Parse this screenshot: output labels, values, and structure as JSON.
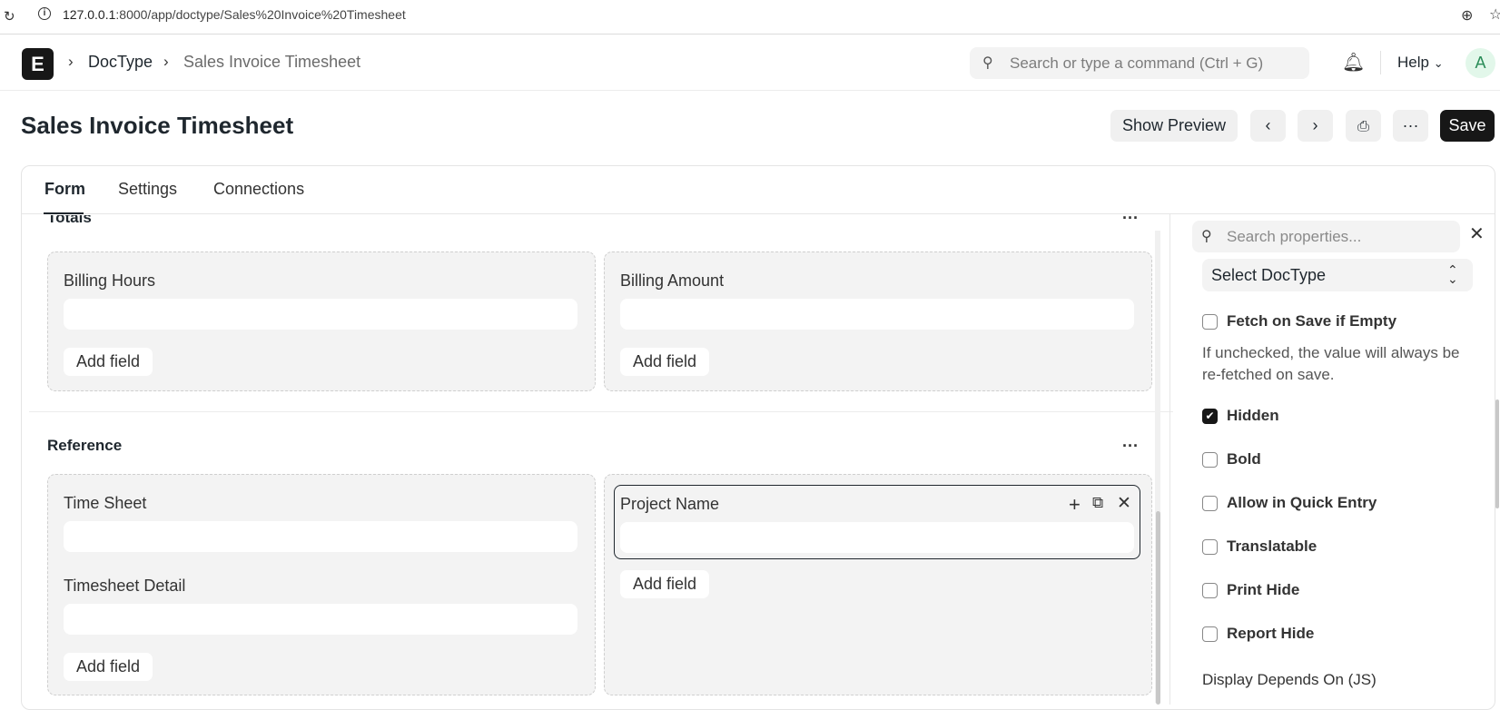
{
  "browser": {
    "url_host": "127.0.0.1",
    "url_rest": ":8000/app/doctype/Sales%20Invoice%20Timesheet"
  },
  "nav": {
    "logo": "E",
    "breadcrumbs": [
      "DocType",
      "Sales Invoice Timesheet"
    ],
    "search_placeholder": "Search or type a command (Ctrl + G)",
    "help_label": "Help",
    "avatar_initial": "A"
  },
  "page": {
    "title": "Sales Invoice Timesheet",
    "show_preview": "Show Preview",
    "save": "Save",
    "more": "···"
  },
  "tabs": [
    "Form",
    "Settings",
    "Connections"
  ],
  "form": {
    "section_totals": {
      "title": "Totals",
      "columns": [
        {
          "fields": [
            "Billing Hours"
          ],
          "add_field": "Add field"
        },
        {
          "fields": [
            "Billing Amount"
          ],
          "add_field": "Add field"
        }
      ]
    },
    "section_reference": {
      "title": "Reference",
      "columns": [
        {
          "fields": [
            "Time Sheet",
            "Timesheet Detail"
          ],
          "add_field": "Add field"
        },
        {
          "fields": [
            "Project Name"
          ],
          "add_field": "Add field"
        }
      ]
    }
  },
  "sidebar": {
    "search_placeholder": "Search properties...",
    "select_doctype": "Select DocType",
    "fetch_on_save": "Fetch on Save if Empty",
    "fetch_desc": "If unchecked, the value will always be re-fetched on save.",
    "checkboxes": [
      {
        "label": "Hidden",
        "checked": true
      },
      {
        "label": "Bold",
        "checked": false
      },
      {
        "label": "Allow in Quick Entry",
        "checked": false
      },
      {
        "label": "Translatable",
        "checked": false
      },
      {
        "label": "Print Hide",
        "checked": false
      },
      {
        "label": "Report Hide",
        "checked": false
      }
    ],
    "display_depends_on": "Display Depends On (JS)"
  },
  "colors": {
    "accent_dark": "#171717",
    "column_bg": "#f3f3f3",
    "avatar_bg": "#e2f7ea"
  }
}
